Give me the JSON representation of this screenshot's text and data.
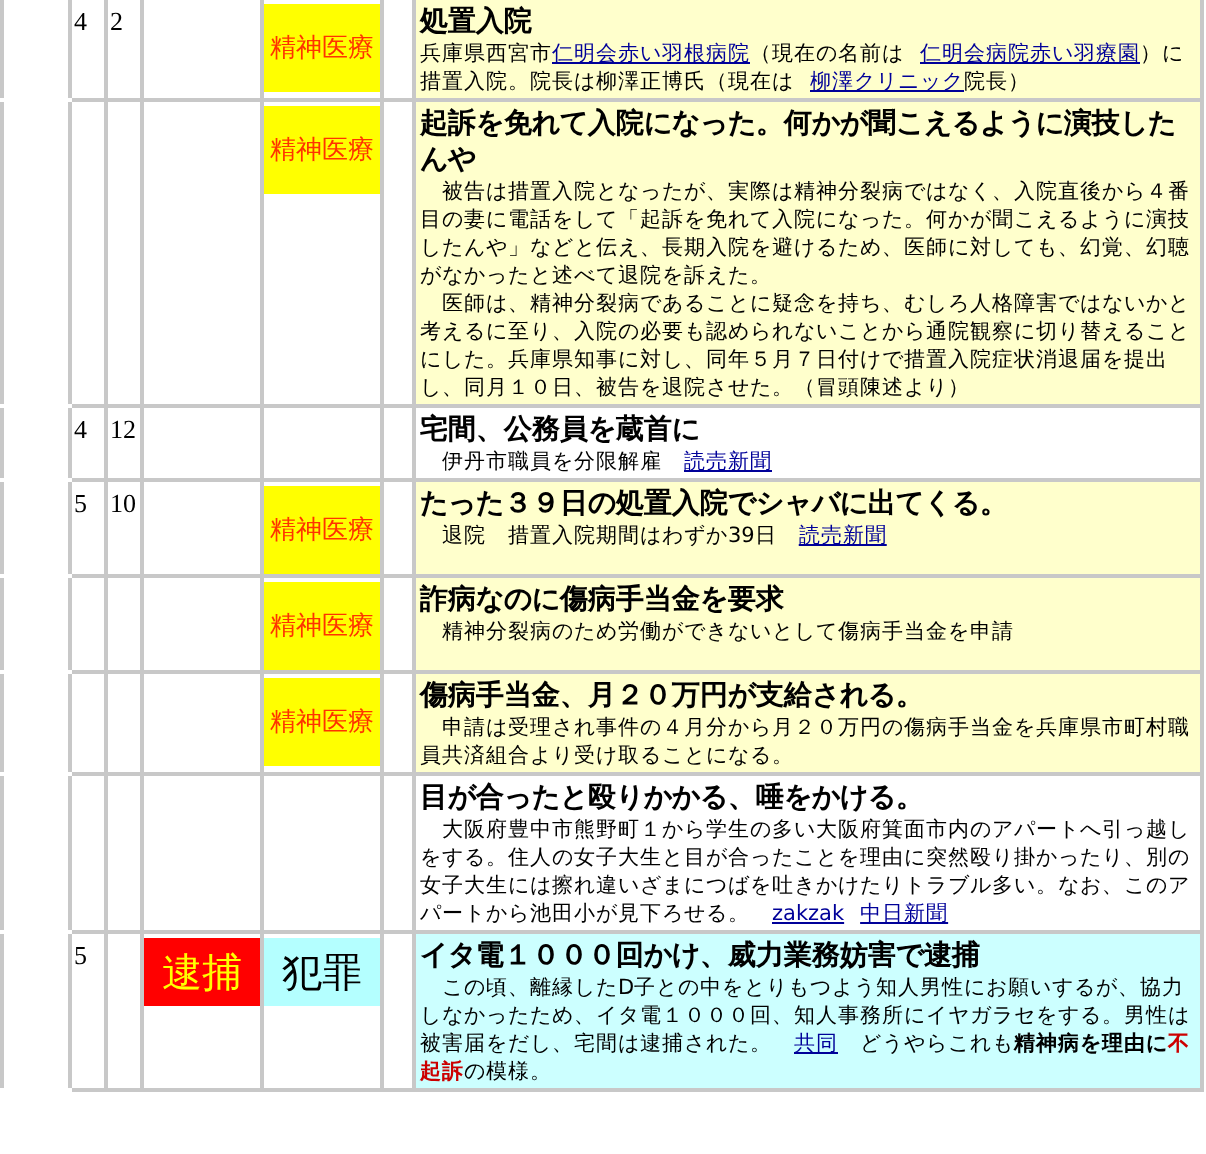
{
  "rows": [
    {
      "month": "4",
      "day": "2",
      "kind": "psychiatry",
      "tag_a": null,
      "tag_b": {
        "text": "精神医療",
        "kind": "psychiatry"
      },
      "title": "処置入院",
      "body": [
        [
          {
            "kind": "text",
            "text": "兵庫県西宮市"
          },
          {
            "kind": "link",
            "text": "仁明会赤い羽根病院"
          },
          {
            "kind": "text",
            "text": "（現在の名前は"
          },
          {
            "kind": "link",
            "text": "仁明会病院赤い羽療園"
          },
          {
            "kind": "text",
            "text": "）に措置入院。院長は柳澤正博氏（現在は"
          },
          {
            "kind": "link",
            "text": "柳澤クリニック"
          },
          {
            "kind": "text",
            "text": "院長）"
          }
        ]
      ]
    },
    {
      "month": "",
      "day": "",
      "kind": "psychiatry",
      "tag_a": null,
      "tag_b": {
        "text": "精神医療",
        "kind": "psychiatry"
      },
      "title": "起訴を免れて入院になった。何かが聞こえるように演技したんや",
      "body": [
        [
          {
            "kind": "text",
            "text": "　被告は措置入院となったが、実際は精神分裂病ではなく、入院直後から４番目の妻に電話をして「起訴を免れて入院になった。何かが聞こえるように演技したんや」などと伝え、長期入院を避けるため、医師に対しても、幻覚、幻聴がなかったと述べて退院を訴えた。"
          }
        ],
        [
          {
            "kind": "text",
            "text": "　医師は、精神分裂病であることに疑念を持ち、むしろ人格障害ではないかと考えるに至り、入院の必要も認められないことから通院観察に切り替えることにした。兵庫県知事に対し、同年５月７日付けで措置入院症状消退届を提出し、同月１０日、被告を退院させた。（冒頭陳述より）"
          }
        ]
      ]
    },
    {
      "month": "4",
      "day": "12",
      "kind": "plain",
      "tag_a": null,
      "tag_b": null,
      "title": "宅間、公務員を蔵首に",
      "body": [
        [
          {
            "kind": "text",
            "text": "　伊丹市職員を分限解雇　"
          },
          {
            "kind": "link",
            "text": "読売新聞"
          }
        ]
      ]
    },
    {
      "month": "5",
      "day": "10",
      "kind": "psychiatry",
      "tag_a": null,
      "tag_b": {
        "text": "精神医療",
        "kind": "psychiatry"
      },
      "title": "たった３９日の処置入院でシャバに出てくる。",
      "body": [
        [
          {
            "kind": "text",
            "text": "　退院　措置入院期間はわずか39日　"
          },
          {
            "kind": "link",
            "text": "読売新聞"
          }
        ]
      ]
    },
    {
      "month": "",
      "day": "",
      "kind": "psychiatry",
      "tag_a": null,
      "tag_b": {
        "text": "精神医療",
        "kind": "psychiatry"
      },
      "title": "詐病なのに傷病手当金を要求",
      "body": [
        [
          {
            "kind": "text",
            "text": "　精神分裂病のため労働ができないとして傷病手当金を申請"
          }
        ]
      ]
    },
    {
      "month": "",
      "day": "",
      "kind": "psychiatry",
      "tag_a": null,
      "tag_b": {
        "text": "精神医療",
        "kind": "psychiatry"
      },
      "title": "傷病手当金、月２０万円が支給される。",
      "body": [
        [
          {
            "kind": "text",
            "text": "　申請は受理され事件の４月分から月２０万円の傷病手当金を兵庫県市町村職員共済組合より受け取ることになる。"
          }
        ]
      ]
    },
    {
      "month": "",
      "day": "",
      "kind": "plain",
      "tag_a": null,
      "tag_b": null,
      "title": "目が合ったと殴りかかる、唾をかける。",
      "body": [
        [
          {
            "kind": "text",
            "text": "　大阪府豊中市熊野町１から学生の多い大阪府箕面市内のアパートへ引っ越しをする。住人の女子大生と目が合ったことを理由に突然殴り掛かったり、別の女子大生には擦れ違いざまにつばを吐きかけたりトラブル多い。なお、このアパートから池田小が見下ろせる。　"
          },
          {
            "kind": "link",
            "text": "zakzak"
          },
          {
            "kind": "link",
            "text": "中日新聞"
          }
        ]
      ]
    },
    {
      "month": "5",
      "day": "",
      "kind": "crime",
      "tag_a": {
        "text": "逮捕",
        "kind": "arrest"
      },
      "tag_b": {
        "text": "犯罪",
        "kind": "crime"
      },
      "title": "イタ電１０００回かけ、威力業務妨害で逮捕",
      "body": [
        [
          {
            "kind": "text",
            "text": "　この頃、離縁したD子との中をとりもつよう知人男性にお願いするが、協力しなかったため、イタ電１０００回、知人事務所にイヤガラセをする。男性は被害届をだし、宅間は逮捕された。　"
          },
          {
            "kind": "link",
            "text": "共同"
          },
          {
            "kind": "text",
            "text": "　どうやらこれも"
          },
          {
            "kind": "bold",
            "text": "精神病を理由に"
          },
          {
            "kind": "alert",
            "text": "不起訴"
          },
          {
            "kind": "text",
            "text": "の模様。"
          }
        ]
      ]
    }
  ]
}
